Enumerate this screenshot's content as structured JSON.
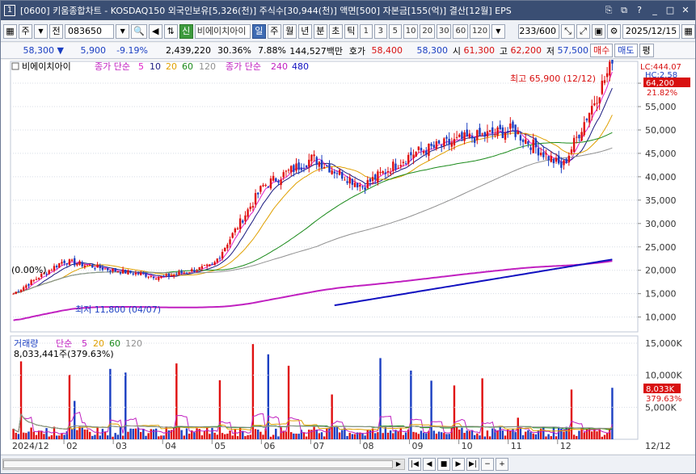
{
  "title_bar": {
    "window_number": "1",
    "title": "[0600] 키움종합차트 - KOSDAQ150 외국인보유[5,326(천)] 주식수[30,944(천)] 액면[500] 자본금[155(억)] 결산[12월] EPS",
    "icons": [
      "restore-icon",
      "copy-icon",
      "help-icon",
      "minimize-icon",
      "maximize-icon",
      "close-icon"
    ]
  },
  "toolbar": {
    "market": "주",
    "prev_label": "전",
    "code": "083650",
    "credit_badge": "신",
    "stock_name": "비에이치아이",
    "periods": [
      "일",
      "주",
      "월",
      "년",
      "분",
      "초",
      "틱"
    ],
    "active_period": "일",
    "intervals": [
      "1",
      "3",
      "5",
      "10",
      "20",
      "30",
      "60",
      "120"
    ],
    "data_count": "233/600",
    "date": "2025/12/15"
  },
  "info_bar": {
    "price": "58,300",
    "change": "5,900",
    "change_pct": "-9.19%",
    "volume": "2,439,220",
    "turnover": "30.36%",
    "prev_ratio": "7.88%",
    "amount": "144,527백만",
    "bid_label": "호가",
    "ask_price": "58,400",
    "bid_price": "58,300",
    "open_label": "시",
    "open": "61,300",
    "high_label": "고",
    "high": "62,200",
    "low_label": "저",
    "low": "57,500",
    "buy_label": "매수",
    "sell_label": "매도",
    "eval_label": "평"
  },
  "price_legend": {
    "stock_name": "비에이치아이",
    "ma_label": "종가 단순",
    "ma_periods": [
      "5",
      "10",
      "20",
      "60",
      "120"
    ],
    "ma_colors": [
      "#e020c8",
      "#1a1a80",
      "#e0a000",
      "#1a8a1a",
      "#909090"
    ],
    "ma2_label": "종가 단순",
    "ma2_periods": [
      "240",
      "480"
    ],
    "ma2_colors": [
      "#c020c0",
      "#1010c0"
    ]
  },
  "price_panel": {
    "lc_label": "LC:444.07",
    "hc_label": "HC:2.58",
    "current_price_tag": "64,200",
    "current_pct_tag": "21.82%",
    "high_annotation": "최고 65,900 (12/12)",
    "low_annotation": "최저 11,800 (04/07)",
    "left_pct": "(0.00%)",
    "y_ticks": [
      "60,000",
      "55,000",
      "50,000",
      "45,000",
      "40,000",
      "35,000",
      "30,000",
      "25,000",
      "20,000",
      "15,000",
      "10,000"
    ]
  },
  "volume_legend": {
    "label": "거래량",
    "ma_label": "단순",
    "ma_periods": [
      "5",
      "20",
      "60",
      "120"
    ],
    "ma_colors": [
      "#c020c0",
      "#e0a000",
      "#1a8a1a",
      "#909090"
    ],
    "value": "8,033,441주(379.63%)"
  },
  "volume_panel": {
    "y_ticks": [
      "15,000K",
      "10,000K",
      "5,000K"
    ],
    "current_tag": "8,033K",
    "current_pct": "379.63%"
  },
  "x_axis": {
    "labels": [
      "2024/12",
      "02",
      "03",
      "04",
      "05",
      "06",
      "07",
      "08",
      "09",
      "10",
      "11",
      "12",
      "12/12"
    ]
  },
  "bottom_bar": {
    "nav_icons": [
      "first-icon",
      "prev-icon",
      "stop-icon",
      "next-icon",
      "last-icon"
    ]
  },
  "chart_data": {
    "type": "candlestick",
    "y_range": [
      7000,
      64500
    ],
    "series_close_months": [
      {
        "month": "2024/12",
        "close": 15000
      },
      {
        "month": "01",
        "close": 22000
      },
      {
        "month": "02",
        "close": 20000
      },
      {
        "month": "03",
        "close": 18500
      },
      {
        "month": "04",
        "close": 21000
      },
      {
        "month": "05",
        "close": 38000
      },
      {
        "month": "06",
        "close": 44000
      },
      {
        "month": "07",
        "close": 38000
      },
      {
        "month": "08",
        "close": 45000
      },
      {
        "month": "09",
        "close": 48000
      },
      {
        "month": "10",
        "close": 50000
      },
      {
        "month": "11",
        "close": 42000
      },
      {
        "month": "12",
        "close": 64200
      }
    ],
    "high": 65900,
    "low": 11800,
    "volume_range": [
      0,
      16000000
    ]
  }
}
